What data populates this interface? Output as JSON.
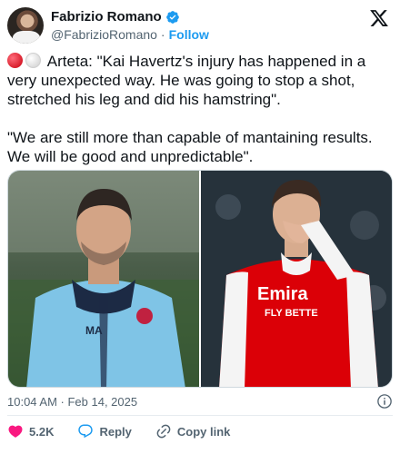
{
  "author": {
    "display_name": "Fabrizio Romano",
    "handle": "@FabrizioRomano",
    "separator": "·",
    "follow_label": "Follow"
  },
  "tweet": {
    "paragraph1": "Arteta: \"Kai Havertz's injury has happened in a very unexpected way. He was going to stop a shot, stretched his leg and did his hamstring\".",
    "paragraph2": "\"We are still more than capable of mantaining results. We will be good and unpredictable\"."
  },
  "media": {
    "left_shirt_initials": "MA",
    "right_shirt_sponsor_line1": "Emira",
    "right_shirt_sponsor_line2": "FLY BETTE"
  },
  "meta": {
    "timestamp": "10:04 AM · Feb 14, 2025"
  },
  "actions": {
    "like_count": "5.2K",
    "reply_label": "Reply",
    "copy_label": "Copy link"
  },
  "colors": {
    "accent": "#1d9bf0",
    "like": "#f91880",
    "text_secondary": "#536471"
  },
  "icons": [
    "verified-badge-icon",
    "x-logo-icon",
    "info-icon",
    "heart-icon",
    "reply-icon",
    "link-icon"
  ]
}
